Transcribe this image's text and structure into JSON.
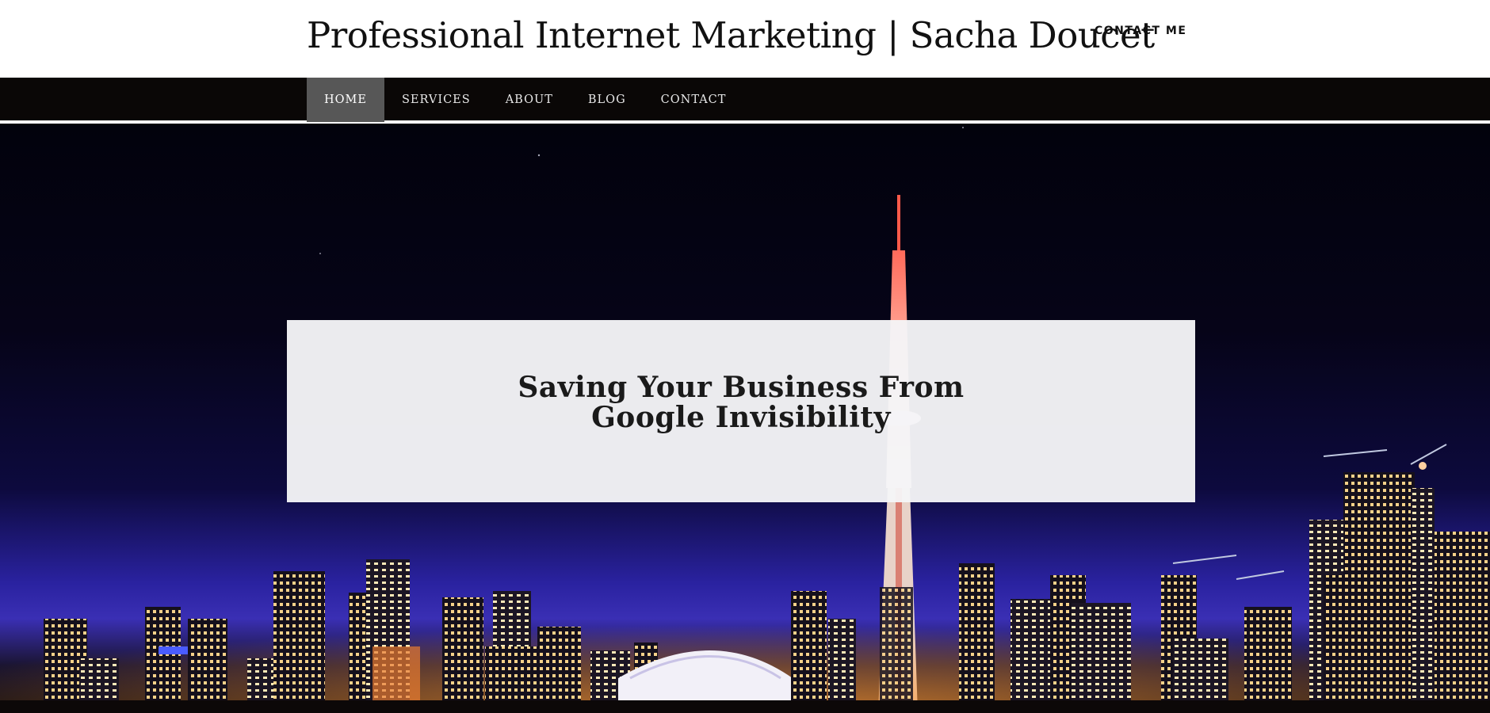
{
  "header": {
    "site_title": "Professional Internet Marketing | Sacha Doucet",
    "contact_link": "CONTACT ME"
  },
  "nav": {
    "items": [
      {
        "label": "HOME",
        "active": true
      },
      {
        "label": "SERVICES",
        "active": false
      },
      {
        "label": "ABOUT",
        "active": false
      },
      {
        "label": "BLOG",
        "active": false
      },
      {
        "label": "CONTACT",
        "active": false
      }
    ]
  },
  "hero": {
    "heading_line1": "Saving Your Business From",
    "heading_line2": "Google Invisibility",
    "background_image": "city-skyline-night-photo"
  },
  "colors": {
    "nav_background": "#0a0706",
    "nav_active": "#575757",
    "card_background": "#f5f5f7"
  }
}
